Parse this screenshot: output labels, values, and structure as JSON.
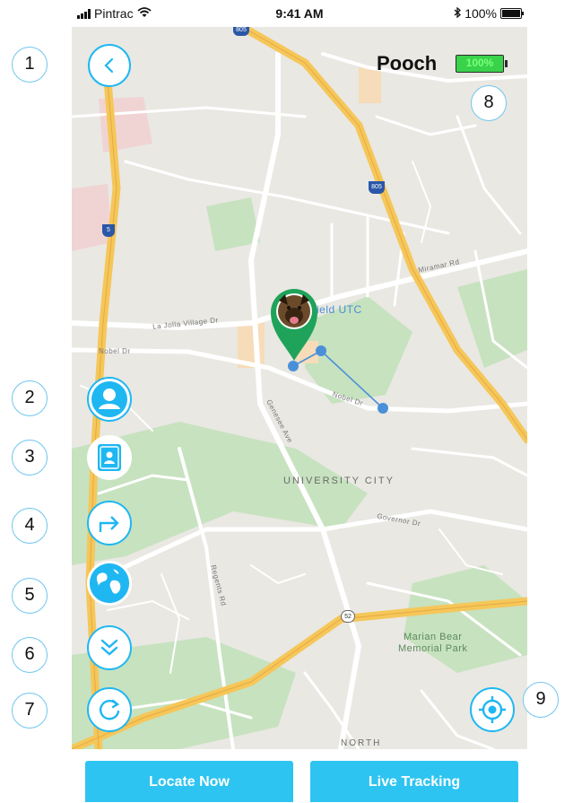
{
  "status_bar": {
    "carrier": "Pintrac",
    "time": "9:41 AM",
    "battery": "100%"
  },
  "header": {
    "pet_name": "Pooch",
    "battery": "100%"
  },
  "map": {
    "labels": {
      "venue": "ield UTC",
      "district": "UNIVERSITY CITY",
      "park": "Marian Bear\nMemorial Park",
      "north": "NORTH",
      "miramar": "Miramar Rd",
      "nobel": "Nobel Dr",
      "nobel2": "Nobel Dr",
      "lajolla": "La Jolla Village Dr",
      "governor": "Governor Dr",
      "genesee": "Genesee Ave",
      "regents": "Regents Rd",
      "shield805a": "805",
      "shield805b": "805",
      "shield52": "52",
      "shield5": "5"
    }
  },
  "annotations": [
    "1",
    "2",
    "3",
    "4",
    "5",
    "6",
    "7",
    "8",
    "9"
  ],
  "buttons": {
    "locate_now": "Locate Now",
    "live_tracking": "Live Tracking"
  },
  "colors": {
    "accent": "#2ec4f1",
    "pin": "#1fa35a",
    "track": "#4a90d9",
    "battery_fill": "#39d24a"
  }
}
